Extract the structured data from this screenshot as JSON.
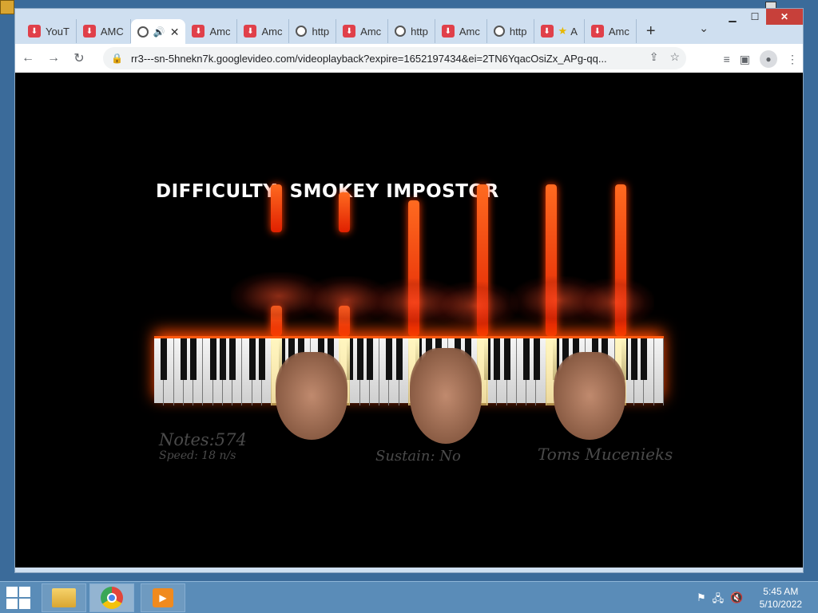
{
  "browser": {
    "tabs": [
      {
        "label": "YouT",
        "icon": "download-icon"
      },
      {
        "label": "AMC",
        "icon": "download-icon"
      },
      {
        "label": "",
        "icon": "globe-icon",
        "active": true
      },
      {
        "label": "Amc",
        "icon": "download-icon"
      },
      {
        "label": "Amc",
        "icon": "download-icon"
      },
      {
        "label": "http",
        "icon": "globe-icon"
      },
      {
        "label": "Amc",
        "icon": "download-icon"
      },
      {
        "label": "http",
        "icon": "globe-icon"
      },
      {
        "label": "Amc",
        "icon": "download-icon"
      },
      {
        "label": "http",
        "icon": "globe-icon"
      },
      {
        "label": "A",
        "icon": "download-icon"
      },
      {
        "label": "Amc",
        "icon": "download-icon"
      }
    ],
    "url": "rr3---sn-5hnekn7k.googlevideo.com/videoplayback?expire=1652197434&ei=2TN6YqacOsiZx_APg-qq..."
  },
  "video": {
    "difficulty": "DIFFICULTY: SMOKEY IMPOSTOR",
    "notes": "Notes:574",
    "speed": "Speed: 18 n/s",
    "sustain": "Sustain: No",
    "author": "Toms Mucenieks"
  },
  "taskbar": {
    "time": "5:45 AM",
    "date": "5/10/2022"
  },
  "colors": {
    "accent": "#ff4a10",
    "taskbar": "#5a8cb8",
    "close": "#c7403a"
  }
}
